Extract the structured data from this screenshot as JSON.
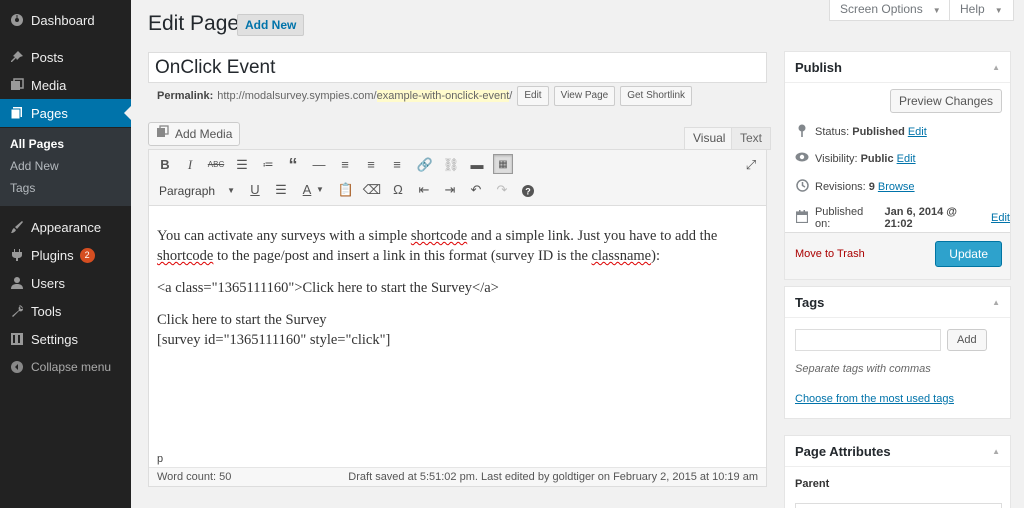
{
  "sidebar": {
    "items": [
      {
        "label": "Dashboard",
        "icon": "dashboard-icon"
      },
      {
        "label": "Posts",
        "icon": "pin-icon"
      },
      {
        "label": "Media",
        "icon": "media-icon"
      },
      {
        "label": "Pages",
        "icon": "pages-icon"
      },
      {
        "label": "Appearance",
        "icon": "paintbrush-icon"
      },
      {
        "label": "Plugins",
        "icon": "plug-icon",
        "badge": "2"
      },
      {
        "label": "Users",
        "icon": "user-icon"
      },
      {
        "label": "Tools",
        "icon": "wrench-icon"
      },
      {
        "label": "Settings",
        "icon": "settings-icon"
      }
    ],
    "submenu": [
      "All Pages",
      "Add New",
      "Tags"
    ],
    "collapse_label": "Collapse menu",
    "active_color": "#0073aa"
  },
  "header": {
    "title": "Edit Page",
    "add_new": "Add New",
    "screen_options": "Screen Options",
    "help": "Help"
  },
  "post": {
    "title": "OnClick Event",
    "permalink_label": "Permalink:",
    "permalink_base": "http://modalsurvey.sympies.com/",
    "permalink_slug": "example-with-onclick-event",
    "permalink_end": "/",
    "edit_btn": "Edit",
    "view_btn": "View Page",
    "shortlink_btn": "Get Shortlink"
  },
  "editor": {
    "add_media": "Add Media",
    "tab_visual": "Visual",
    "tab_text": "Text",
    "format_select": "Paragraph",
    "content": {
      "p1_a": "You can activate any surveys with a simple ",
      "p1_b": "shortcode",
      "p1_c": " and a simple link. Just you have to add the ",
      "p1_d": "shortcode",
      "p1_e": " to the page/post and insert a link in this format (survey ID is the ",
      "p1_f": "classname",
      "p1_g": "):",
      "p2": "<a class=\"1365111160\">Click here to start the Survey</a>",
      "p3_line1": "Click here to start the Survey",
      "p3_line2": "[survey id=\"1365111160\" style=\"click\"]"
    },
    "path": "p",
    "word_count": "Word count: 50",
    "draft_status": "Draft saved at 5:51:02 pm. Last edited by goldtiger on February 2, 2015 at 10:19 am"
  },
  "publish": {
    "title": "Publish",
    "preview": "Preview Changes",
    "status_label": "Status:",
    "status_value": "Published",
    "visibility_label": "Visibility:",
    "visibility_value": "Public",
    "revisions_label": "Revisions:",
    "revisions_value": "9",
    "browse": "Browse",
    "published_label": "Published on:",
    "published_value": "Jan 6, 2014 @ 21:02",
    "edit": "Edit",
    "trash": "Move to Trash",
    "update": "Update",
    "primary_color": "#2ea2cc"
  },
  "tags": {
    "title": "Tags",
    "add": "Add",
    "hint": "Separate tags with commas",
    "choose": "Choose from the most used tags"
  },
  "attributes": {
    "title": "Page Attributes",
    "parent_label": "Parent"
  }
}
